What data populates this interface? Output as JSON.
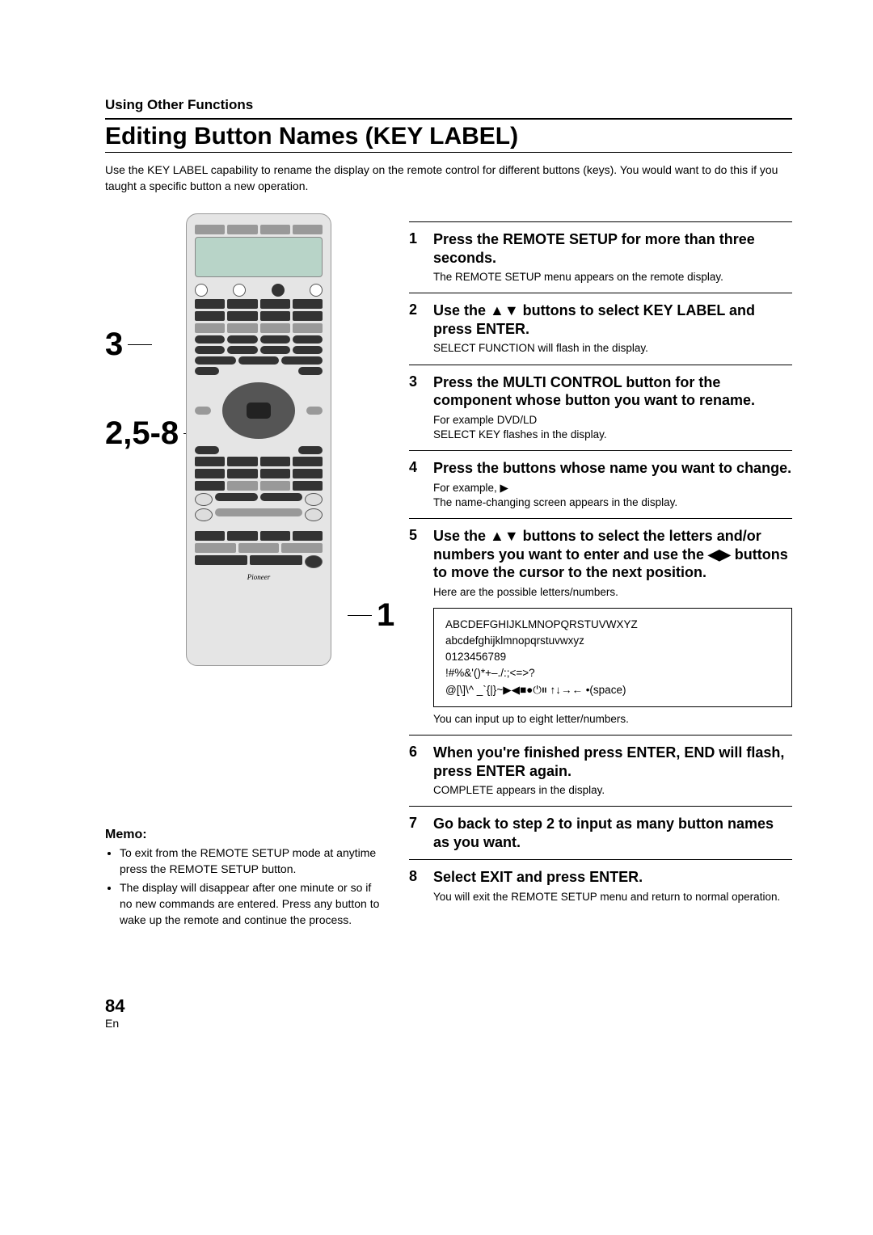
{
  "section_label": "Using Other Functions",
  "main_heading": "Editing Button Names (KEY LABEL)",
  "intro": "Use the KEY LABEL capability to rename the display on the remote control for different buttons (keys). You would want to do this if you taught a specific button a new operation.",
  "callouts": {
    "c3": "3",
    "c258": "2,5-8",
    "c1": "1"
  },
  "remote_brand": "Pioneer",
  "memo": {
    "title": "Memo:",
    "items": [
      "To exit from the REMOTE SETUP mode at anytime press the REMOTE SETUP button.",
      "The display will disappear after one minute or so if no new commands are entered. Press any button to wake up the remote and continue the process."
    ]
  },
  "steps": [
    {
      "num": "1",
      "title": "Press the REMOTE SETUP for more than three seconds.",
      "desc": "The REMOTE SETUP menu appears on the remote display."
    },
    {
      "num": "2",
      "title": "Use the ▲▼ buttons to select KEY LABEL and press ENTER.",
      "desc": "SELECT FUNCTION will flash in the display."
    },
    {
      "num": "3",
      "title": "Press the MULTI CONTROL button for the component whose button you want to rename.",
      "desc": "For example DVD/LD\nSELECT KEY flashes in the display."
    },
    {
      "num": "4",
      "title": "Press the buttons whose name you want to change.",
      "desc": "For example, ▶\nThe name-changing screen appears in the display."
    },
    {
      "num": "5",
      "title": "Use the ▲▼ buttons to select the letters and/or numbers you want to enter and use the ◀▶ buttons to move the cursor to the next position.",
      "desc": "Here are the possible letters/numbers.",
      "charbox": {
        "l1": "ABCDEFGHIJKLMNOPQRSTUVWXYZ",
        "l2": "abcdefghijklmnopqrstuvwxyz",
        "l3": "0123456789",
        "l4": "!#%&'()*+–./:;<=>?",
        "l5": "@[\\]\\^ _`{|}~▶◀■●⏻⏸ ↑↓→← •(space)"
      },
      "desc2": "You can input up to eight letter/numbers."
    },
    {
      "num": "6",
      "title": "When you're finished press ENTER, END will flash, press ENTER again.",
      "desc": "COMPLETE appears in the display."
    },
    {
      "num": "7",
      "title": "Go back to step 2 to input as many button names as you want."
    },
    {
      "num": "8",
      "title": "Select EXIT and press ENTER.",
      "desc": "You will exit the REMOTE SETUP menu and return to normal operation."
    }
  ],
  "page_number": "84",
  "page_lang": "En"
}
